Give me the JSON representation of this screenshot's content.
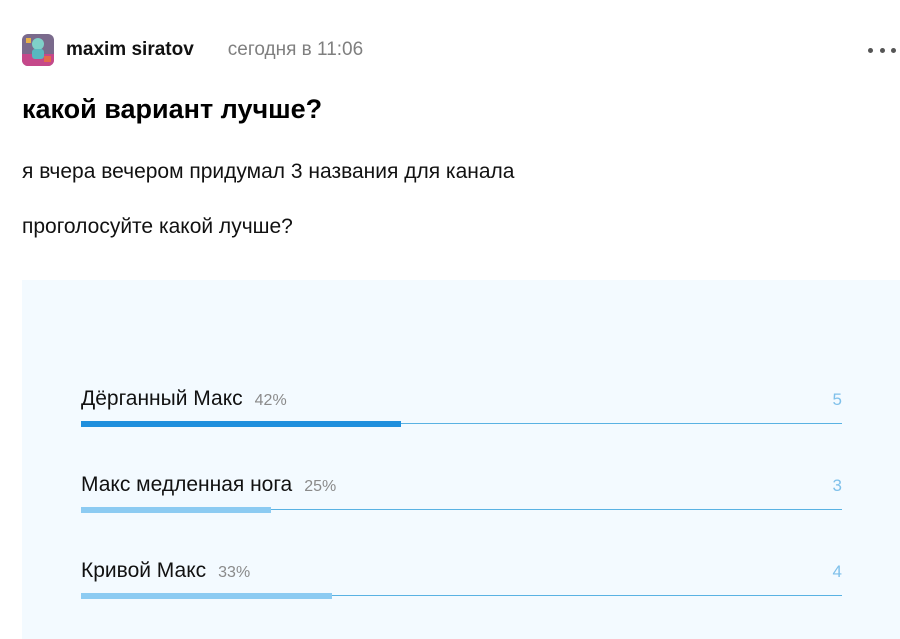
{
  "post": {
    "author": "maxim siratov",
    "timestamp": "сегодня в 11:06",
    "more_icon": "more-horizontal-icon",
    "title": "какой вариант лучше?",
    "paragraphs": [
      "я вчера вечером придумал 3 названия для канала",
      "проголосуйте какой лучше?"
    ]
  },
  "poll": {
    "options": [
      {
        "label": "Дёрганный Макс",
        "percent_text": "42%",
        "percent": 42,
        "votes": "5",
        "leader": true
      },
      {
        "label": "Макс медленная нога",
        "percent_text": "25%",
        "percent": 25,
        "votes": "3",
        "leader": false
      },
      {
        "label": "Кривой Макс",
        "percent_text": "33%",
        "percent": 33,
        "votes": "4",
        "leader": false
      }
    ]
  },
  "colors": {
    "leader_bar": "#1f8fdd",
    "other_bar": "#8ccbf2",
    "poll_background": "#f3faff",
    "vote_count": "#7fc0ea"
  }
}
